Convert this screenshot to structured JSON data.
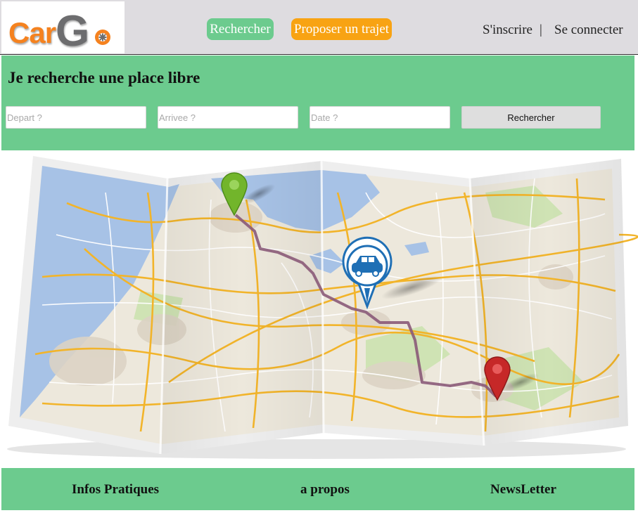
{
  "brand": {
    "logo_prefix": "Car",
    "logo_letter": "G",
    "logo_suffix": "o"
  },
  "nav": {
    "search_label": "Rechercher",
    "propose_label": "Proposer un trajet"
  },
  "auth": {
    "signup_label": "S'inscrire",
    "separator": "|",
    "login_label": "Se connecter"
  },
  "search": {
    "title": "Je recherche une place libre",
    "depart_placeholder": "Depart ?",
    "arrivee_placeholder": "Arrivee ?",
    "date_placeholder": "Date ?",
    "submit_label": "Rechercher"
  },
  "map": {
    "pins": [
      "start-pin-icon",
      "car-pin-icon",
      "destination-pin-icon"
    ]
  },
  "footer": {
    "infos_label": "Infos Pratiques",
    "about_label": "a propos",
    "newsletter_label": "NewsLetter"
  },
  "colors": {
    "brand_green": "#6ccb8e",
    "brand_orange": "#f8a313",
    "header_gray": "#dedce0",
    "route": "#8a5a78",
    "pin_start": "#72b52b",
    "pin_car": "#1f6fb5",
    "pin_end": "#c62828"
  }
}
